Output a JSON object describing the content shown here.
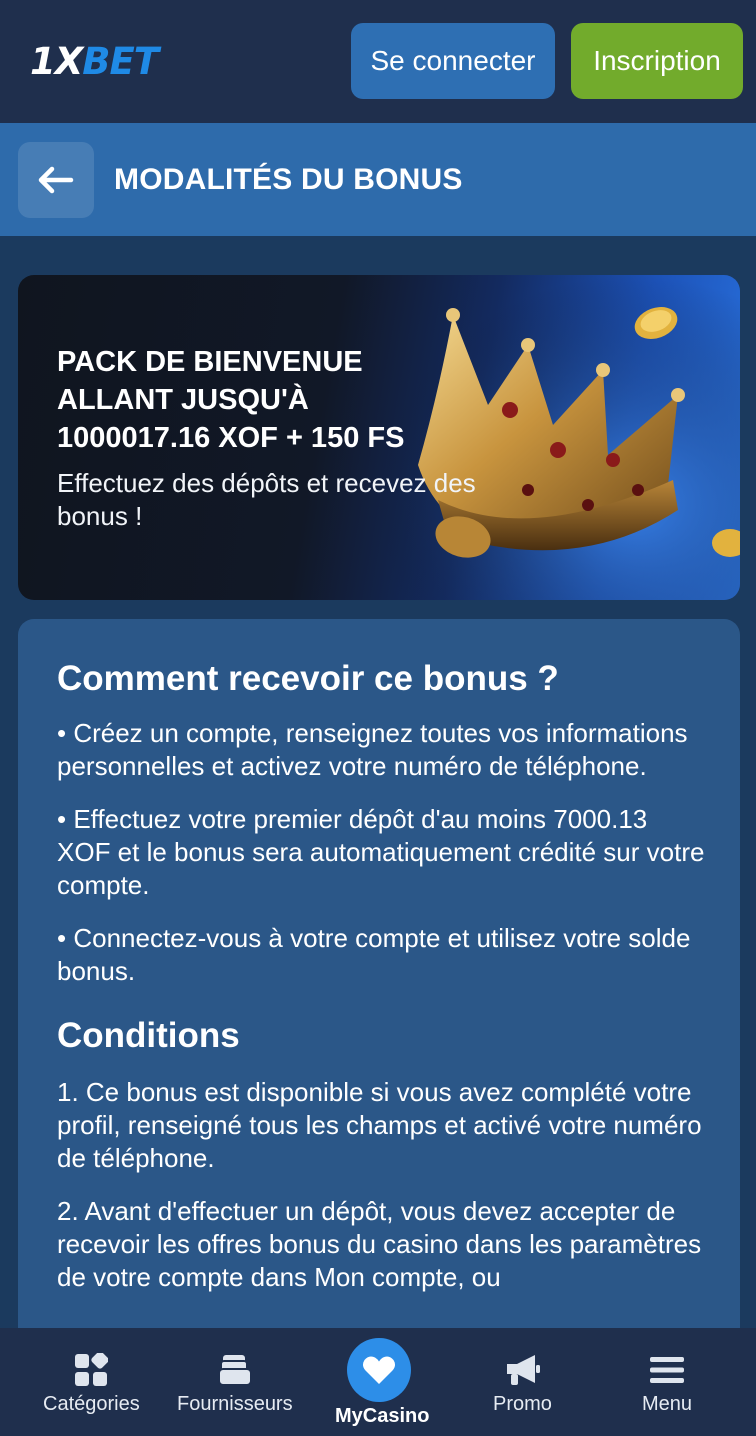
{
  "header": {
    "logo_part1": "1X",
    "logo_part2": "BET",
    "login_label": "Se connecter",
    "register_label": "Inscription"
  },
  "title_bar": {
    "back_icon": "arrow-left-icon",
    "title": "MODALITÉS DU BONUS"
  },
  "banner": {
    "title_lines": [
      "PACK DE BIENVENUE",
      "ALLANT JUSQU'À",
      "1000017.16 XOF + 150 FS"
    ],
    "subtitle": "Effectuez des dépôts et recevez des bonus !"
  },
  "content": {
    "how_heading": "Comment recevoir ce bonus ?",
    "how_steps": [
      "• Créez un compte, renseignez toutes vos informations personnelles et activez votre numéro de téléphone.",
      "• Effectuez votre premier dépôt d'au moins 7000.13 XOF et le bonus sera automatiquement crédité sur votre compte.",
      "• Connectez-vous à votre compte et utilisez votre solde bonus."
    ],
    "conditions_heading": "Conditions",
    "conditions": [
      "1. Ce bonus est disponible si vous avez complété votre profil, renseigné tous les champs et activé votre numéro de téléphone.",
      "2. Avant d'effectuer un dépôt, vous devez accepter de recevoir les offres bonus du casino dans les paramètres de votre compte dans Mon compte, ou"
    ]
  },
  "bottom_nav": {
    "items": [
      {
        "label": "Catégories",
        "icon": "categories-icon"
      },
      {
        "label": "Fournisseurs",
        "icon": "providers-icon"
      },
      {
        "label": "MyCasino",
        "icon": "heart-icon"
      },
      {
        "label": "Promo",
        "icon": "megaphone-icon"
      },
      {
        "label": "Menu",
        "icon": "hamburger-menu-icon"
      }
    ]
  },
  "colors": {
    "header_bg": "#1f2f4d",
    "title_bar_bg": "#2e6bab",
    "page_bg": "#1b3a5e",
    "card_bg": "#2b5788",
    "login_button": "#2e6fb3",
    "register_button": "#72ab2c",
    "accent_blue": "#2d8ee8"
  }
}
